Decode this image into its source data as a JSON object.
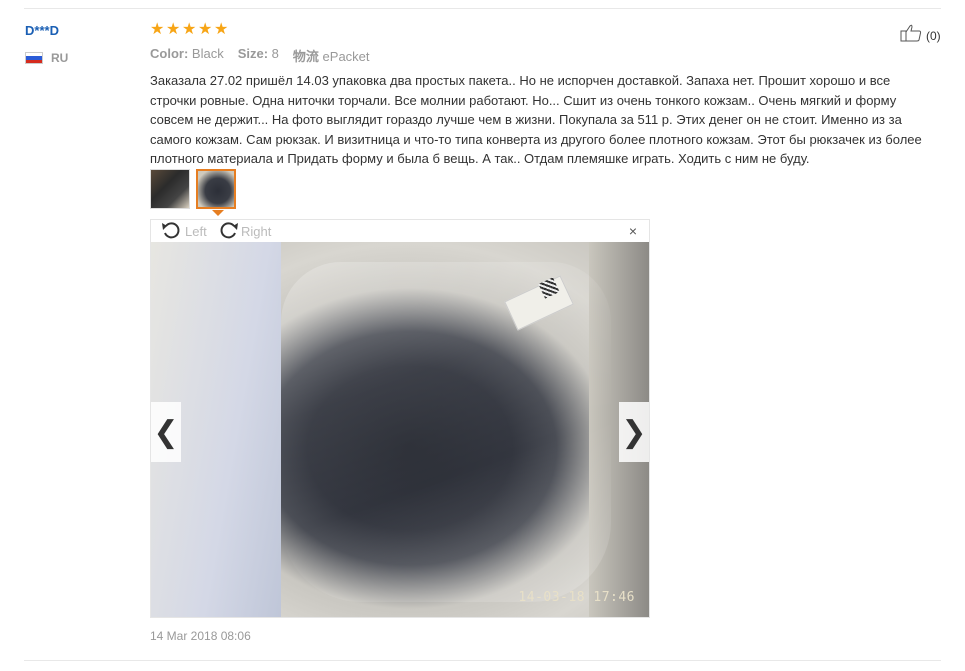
{
  "reviewer": {
    "name": "D***D",
    "country": "RU"
  },
  "rating": {
    "stars": 5,
    "max": 5
  },
  "attributes": [
    {
      "label": "Color:",
      "value": "Black"
    },
    {
      "label": "Size:",
      "value": "8"
    },
    {
      "label": "物流",
      "value": "ePacket"
    }
  ],
  "helpful": {
    "count": "(0)",
    "icon": "thumbs-up-icon"
  },
  "review_text": "Заказала 27.02 пришёл 14.03 упаковка два простых пакета.. Но не испорчен доставкой. Запаха нет. Прошит хорошо и все строчки ровные. Одна ниточки торчали. Все молнии работают. Но... Сшит из очень тонкого кожзам.. Очень мягкий и форму совсем не держит... На фото выглядит гораздо лучше чем в жизни. Покупала за 511 р. Этих денег он не стоит. Именно из за самого кожзам. Сам рюкзак. И визитница и что-то типа конверта из другого более плотного кожзам. Этот бы рюкзачек из более плотного материала и Придать форму и была б вещь. А так.. Отдам племяшке играть. Ходить с ним не буду.",
  "thumbnails": [
    {
      "icon": "photo-thumbnail",
      "active": false
    },
    {
      "icon": "photo-thumbnail",
      "active": true
    }
  ],
  "viewer": {
    "rotate_left_label": "Left",
    "rotate_right_label": "Right",
    "close_symbol": "×",
    "photo_timestamp": "14-03-18 17:46",
    "prev_symbol": "❮",
    "next_symbol": "❯"
  },
  "review_date": "14 Mar 2018 08:06",
  "colors": {
    "star": "#f7a516",
    "username": "#1a5fb4",
    "active_thumb_border": "#e67e22"
  }
}
